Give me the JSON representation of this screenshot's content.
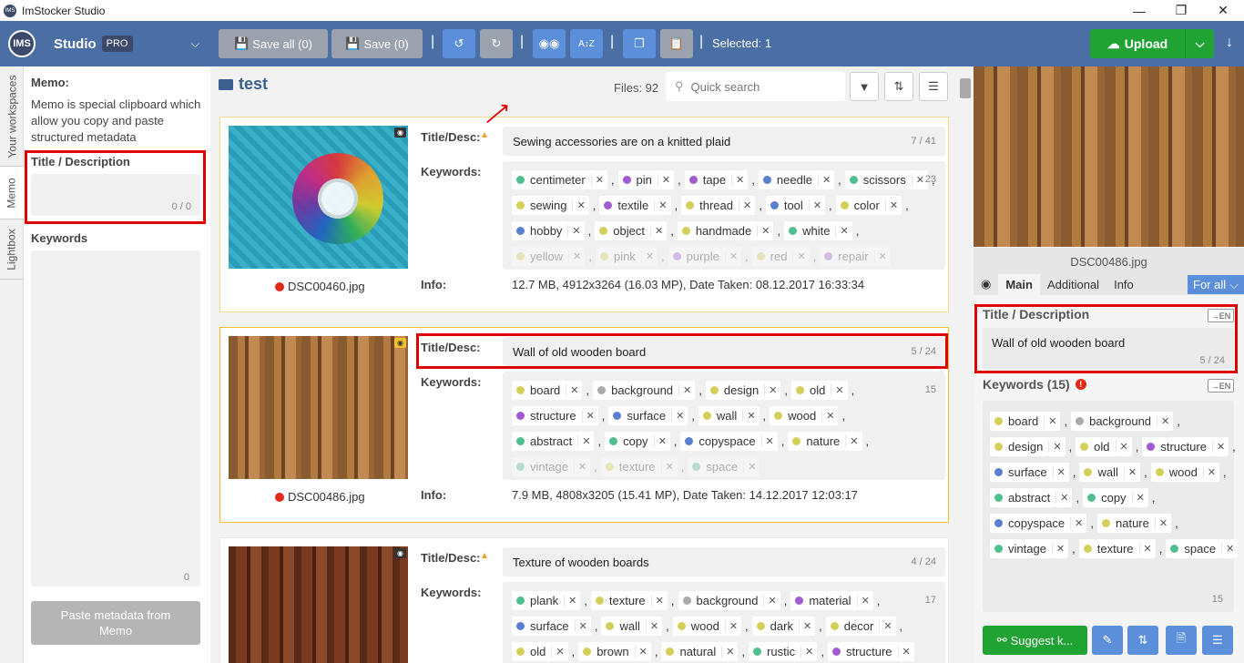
{
  "app": {
    "title": "ImStocker Studio",
    "logo_text": "IMS",
    "studio": "Studio",
    "pro": "PRO"
  },
  "toolbar": {
    "save_all": "Save all (0)",
    "save": "Save (0)",
    "selected": "Selected: 1",
    "upload": "Upload"
  },
  "left_tabs": [
    "Your workspaces",
    "Memo",
    "Lightbox"
  ],
  "memo": {
    "heading": "Memo:",
    "description": "Memo is special clipboard which allow you copy and paste structured metadata",
    "title_label": "Title / Description",
    "title_counter": "0 / 0",
    "keywords_label": "Keywords",
    "keywords_counter": "0",
    "paste_button": "Paste metadata from Memo"
  },
  "center": {
    "folder": "test",
    "files": "Files: 92",
    "search_placeholder": "Quick search",
    "labels": {
      "title": "Title/Desc:",
      "keywords": "Keywords:",
      "info": "Info:"
    },
    "cards": [
      {
        "filename": "DSC00460.jpg",
        "title": "Sewing accessories are on a knitted plaid",
        "title_counter": "7 / 41",
        "kw_count": "23",
        "info": "12.7 MB, 4912x3264 (16.03 MP), Date Taken: 08.12.2017 16:33:34",
        "rows": [
          [
            [
              "centimeter",
              "#4fbf8f"
            ],
            [
              "pin",
              "#a05bd0"
            ],
            [
              "tape",
              "#a05bd0"
            ],
            [
              "needle",
              "#5b7fd0"
            ],
            [
              "scissors",
              "#4fbf8f"
            ]
          ],
          [
            [
              "sewing",
              "#d4cf5a"
            ],
            [
              "textile",
              "#a05bd0"
            ],
            [
              "thread",
              "#d4cf5a"
            ],
            [
              "tool",
              "#5b7fd0"
            ],
            [
              "color",
              "#d4cf5a"
            ]
          ],
          [
            [
              "hobby",
              "#5b7fd0"
            ],
            [
              "object",
              "#d4cf5a"
            ],
            [
              "handmade",
              "#d4cf5a"
            ],
            [
              "white",
              "#4fbf8f"
            ]
          ],
          [
            [
              "yellow",
              "#d4cf5a"
            ],
            [
              "pink",
              "#d4cf5a"
            ],
            [
              "purple",
              "#a05bd0"
            ],
            [
              "red",
              "#d4cf5a"
            ],
            [
              "repair",
              "#a05bd0"
            ]
          ]
        ]
      },
      {
        "filename": "DSC00486.jpg",
        "title": "Wall of old wooden board",
        "title_counter": "5 / 24",
        "kw_count": "15",
        "info": "7.9 MB, 4808x3205 (15.41 MP), Date Taken: 14.12.2017 12:03:17",
        "rows": [
          [
            [
              "board",
              "#d4cf5a"
            ],
            [
              "background",
              "#aaaaaa"
            ],
            [
              "design",
              "#d4cf5a"
            ],
            [
              "old",
              "#d4cf5a"
            ]
          ],
          [
            [
              "structure",
              "#a05bd0"
            ],
            [
              "surface",
              "#5b7fd0"
            ],
            [
              "wall",
              "#d4cf5a"
            ],
            [
              "wood",
              "#d4cf5a"
            ]
          ],
          [
            [
              "abstract",
              "#4fbf8f"
            ],
            [
              "copy",
              "#4fbf8f"
            ],
            [
              "copyspace",
              "#5b7fd0"
            ],
            [
              "nature",
              "#d4cf5a"
            ]
          ],
          [
            [
              "vintage",
              "#4fbf8f"
            ],
            [
              "texture",
              "#d4cf5a"
            ],
            [
              "space",
              "#4fbf8f"
            ]
          ]
        ]
      },
      {
        "filename": "",
        "title": "Texture of wooden boards",
        "title_counter": "4 / 24",
        "kw_count": "17",
        "info": "",
        "rows": [
          [
            [
              "plank",
              "#4fbf8f"
            ],
            [
              "texture",
              "#d4cf5a"
            ],
            [
              "background",
              "#aaaaaa"
            ],
            [
              "material",
              "#a05bd0"
            ]
          ],
          [
            [
              "surface",
              "#5b7fd0"
            ],
            [
              "wall",
              "#d4cf5a"
            ],
            [
              "wood",
              "#d4cf5a"
            ],
            [
              "dark",
              "#d4cf5a"
            ],
            [
              "decor",
              "#d4cf5a"
            ]
          ],
          [
            [
              "old",
              "#d4cf5a"
            ],
            [
              "brown",
              "#d4cf5a"
            ],
            [
              "natural",
              "#d4cf5a"
            ],
            [
              "rustic",
              "#4fbf8f"
            ],
            [
              "structure",
              "#a05bd0"
            ]
          ]
        ]
      }
    ]
  },
  "right": {
    "filename": "DSC00486.jpg",
    "tabs": [
      "Main",
      "Additional",
      "Info"
    ],
    "for_all": "For all",
    "lang": "EN",
    "title_label": "Title / Description",
    "title_value": "Wall of old wooden board",
    "title_counter": "5 / 24",
    "keywords_label": "Keywords (15)",
    "keywords_counter": "15",
    "rows": [
      [
        [
          "board",
          "#d4cf5a"
        ],
        [
          "background",
          "#aaaaaa"
        ]
      ],
      [
        [
          "design",
          "#d4cf5a"
        ],
        [
          "old",
          "#d4cf5a"
        ],
        [
          "structure",
          "#a05bd0"
        ]
      ],
      [
        [
          "surface",
          "#5b7fd0"
        ],
        [
          "wall",
          "#d4cf5a"
        ],
        [
          "wood",
          "#d4cf5a"
        ]
      ],
      [
        [
          "abstract",
          "#4fbf8f"
        ],
        [
          "copy",
          "#4fbf8f"
        ]
      ],
      [
        [
          "copyspace",
          "#5b7fd0"
        ],
        [
          "nature",
          "#d4cf5a"
        ]
      ],
      [
        [
          "vintage",
          "#4fbf8f"
        ],
        [
          "texture",
          "#d4cf5a"
        ],
        [
          "space",
          "#4fbf8f"
        ]
      ]
    ],
    "suggest": "Suggest k..."
  }
}
